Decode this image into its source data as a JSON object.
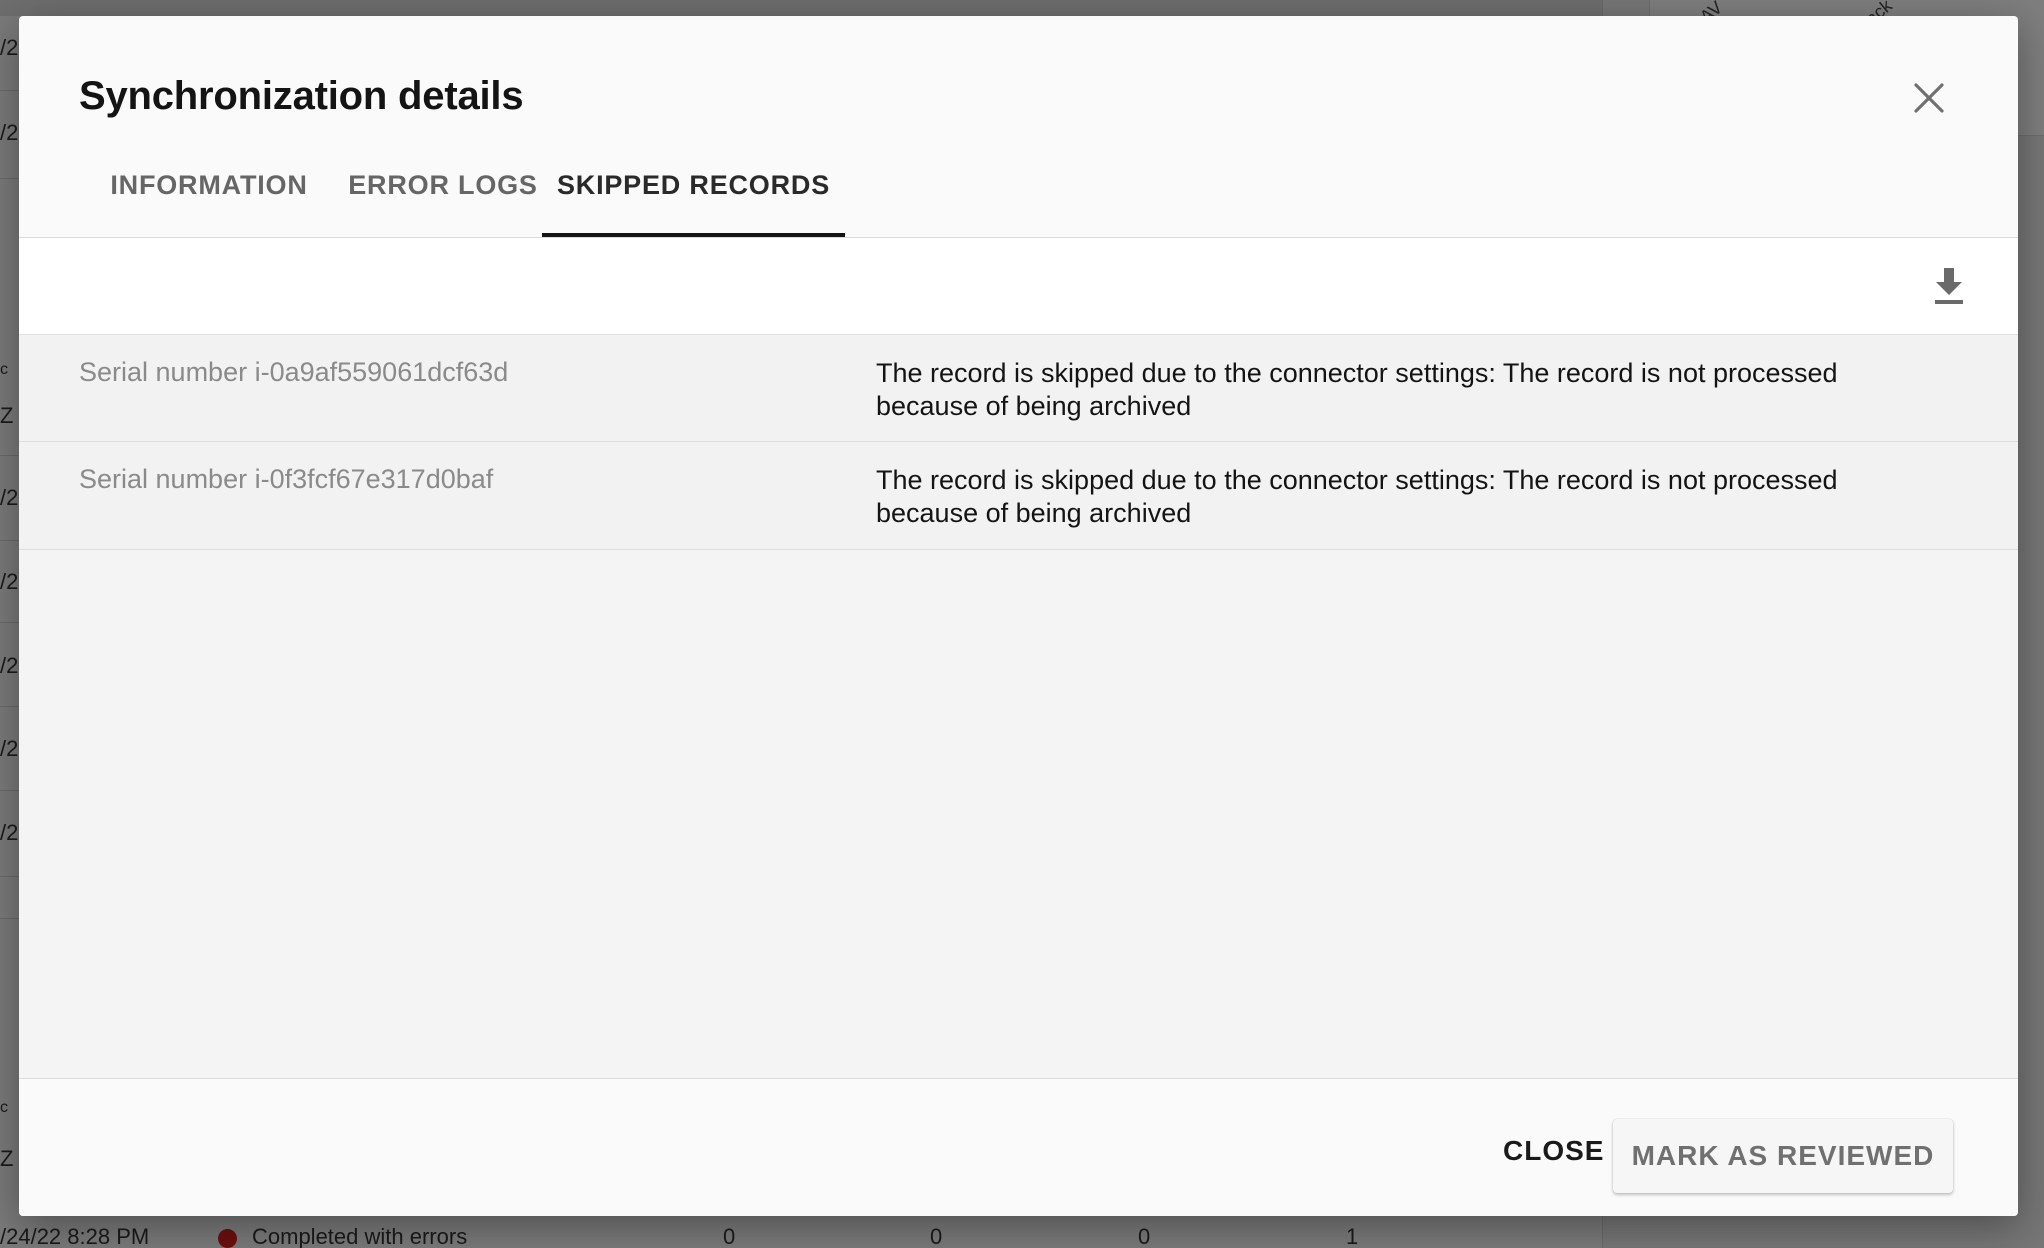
{
  "background": {
    "fragments": [
      "/20",
      "/2",
      "c",
      "Z",
      "/2",
      "/2",
      "/2",
      "/2",
      "/2",
      "c",
      "Z"
    ],
    "side_fragments": [
      "AV",
      "ack"
    ],
    "row": {
      "date": "/24/22 8:28 PM",
      "status": "Completed with errors",
      "col1": "0",
      "col2": "0",
      "col3": "0",
      "col4": "1"
    }
  },
  "dialog": {
    "title": "Synchronization details",
    "tabs": [
      {
        "label": "INFORMATION",
        "active": false
      },
      {
        "label": "ERROR LOGS",
        "active": false
      },
      {
        "label": "SKIPPED RECORDS",
        "active": true
      }
    ],
    "records": [
      {
        "serial": "Serial number i-0a9af559061dcf63d",
        "message": "The record is skipped due to the connector settings: The record is not processed because of being archived"
      },
      {
        "serial": "Serial number i-0f3fcf67e317d0baf",
        "message": "The record is skipped due to the connector settings: The record is not processed because of being archived"
      }
    ],
    "footer": {
      "close_label": "CLOSE",
      "review_label": "MARK AS REVIEWED"
    }
  },
  "icons": {
    "close": "close-icon",
    "download": "download-icon"
  },
  "colors": {
    "overlay": "#7a7a7a",
    "dialog_bg": "#fafafa",
    "active_tab_indicator": "#141414",
    "error_dot": "#6b0f0f"
  }
}
